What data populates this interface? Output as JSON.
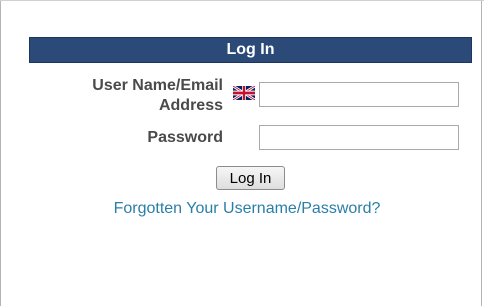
{
  "login": {
    "header": "Log In",
    "username_label": "User Name/Email Address",
    "username_value": "",
    "password_label": "Password",
    "password_value": "",
    "submit_label": "Log In",
    "forgot_link": "Forgotten Your Username/Password?"
  },
  "icons": {
    "language": "uk-flag-icon"
  },
  "colors": {
    "header_bg": "#2c4a78",
    "link": "#2a7fa9",
    "label": "#4a4a4a"
  }
}
